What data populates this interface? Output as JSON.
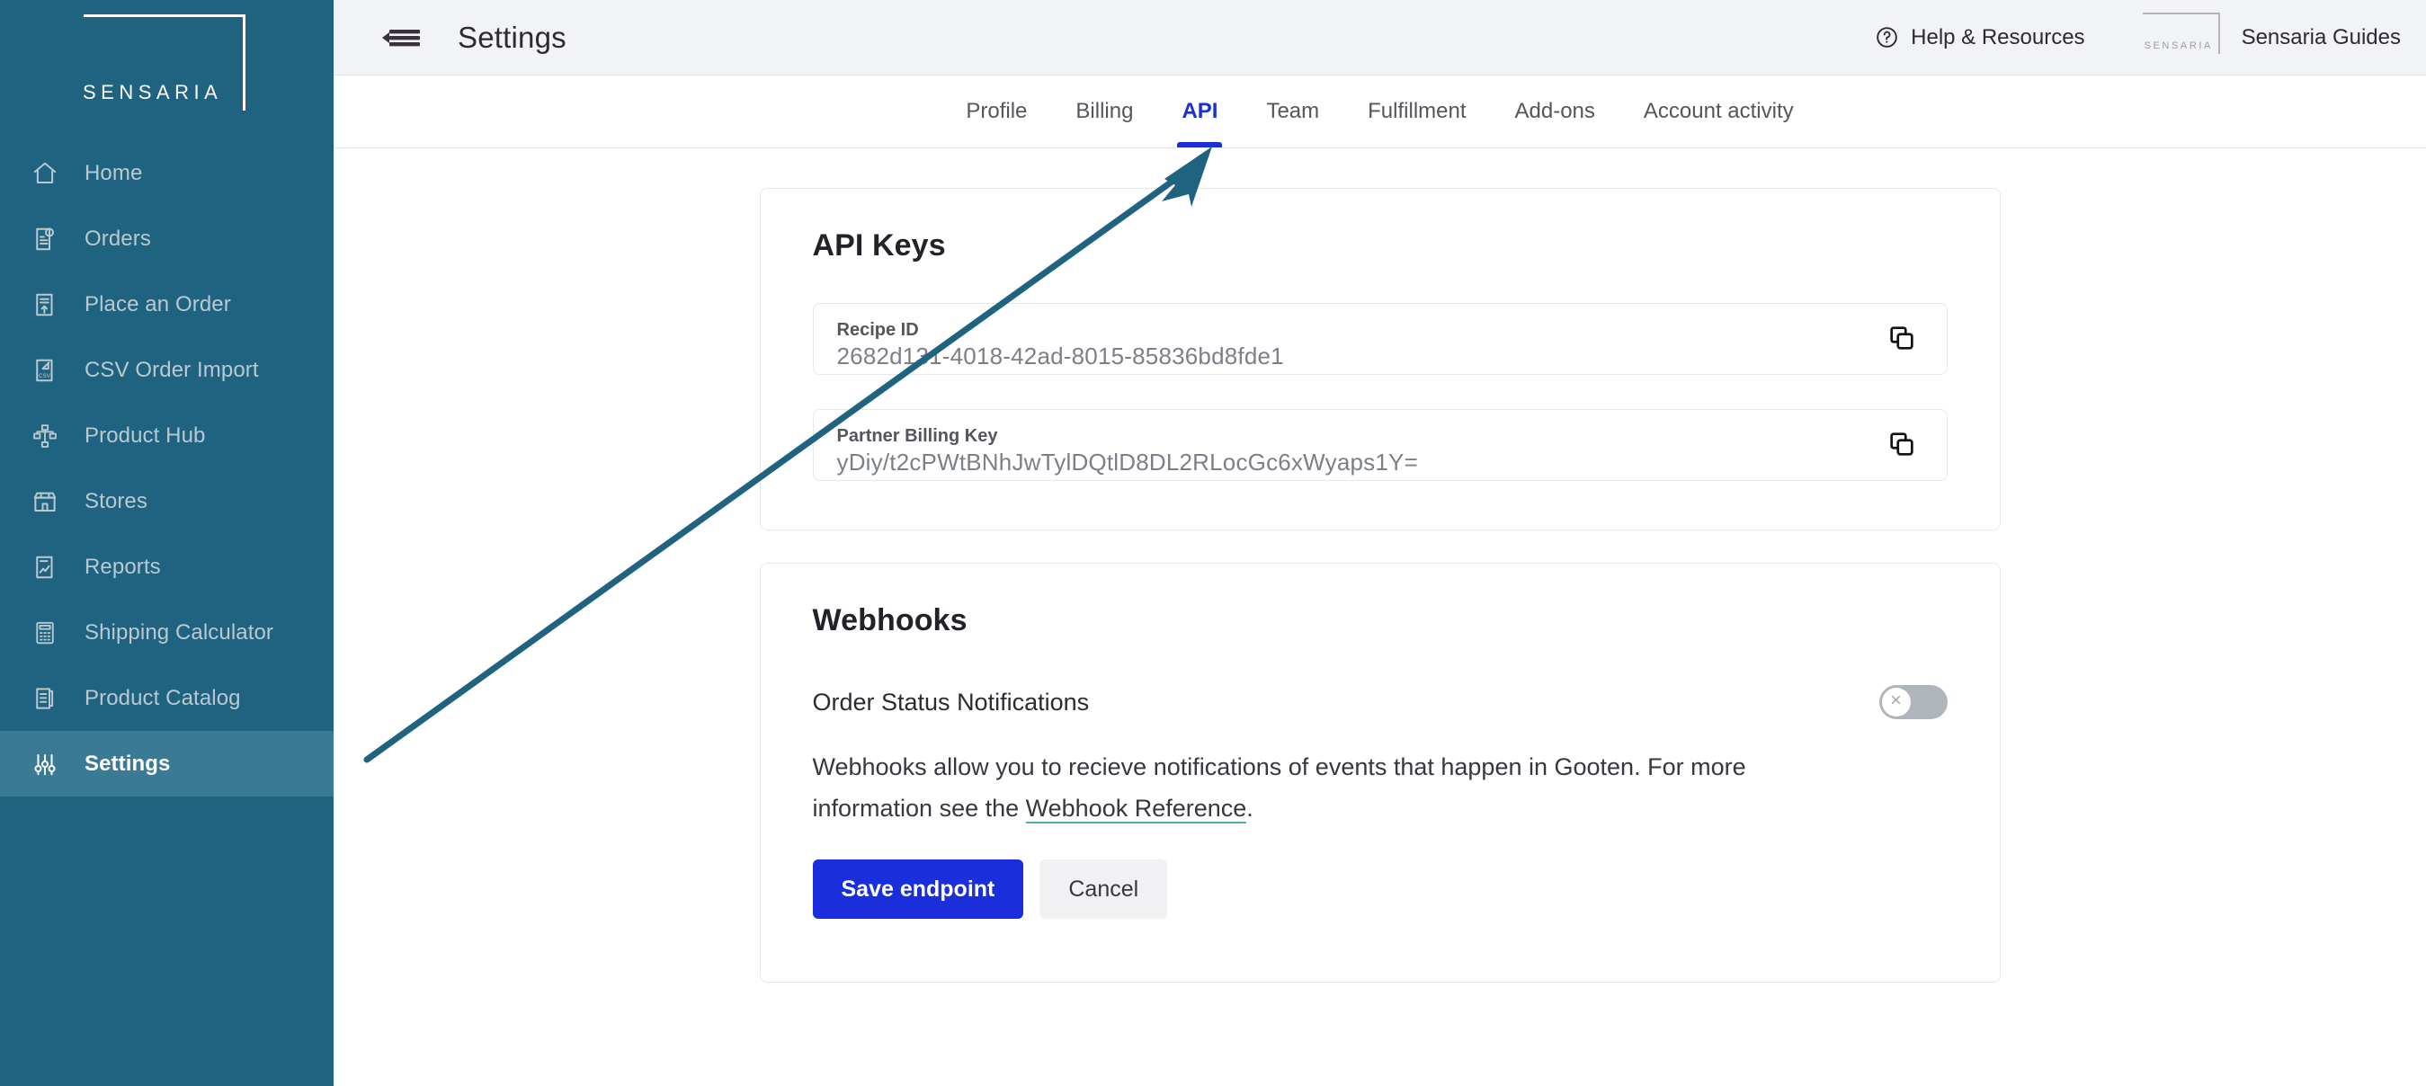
{
  "brand": {
    "logo_text": "SENSARIA",
    "mini_logo_text": "SENSARIA",
    "sidebar_color": "#1F6380",
    "active_item_color": "#3B7A94",
    "accent_color": "#1A2EDB",
    "link_underline_color": "#49b3a5",
    "annotation_color": "#1F6380"
  },
  "sidebar": {
    "items": [
      {
        "label": "Home",
        "icon": "home-icon",
        "active": false
      },
      {
        "label": "Orders",
        "icon": "orders-icon",
        "active": false
      },
      {
        "label": "Place an Order",
        "icon": "place-an-order-icon",
        "active": false
      },
      {
        "label": "CSV Order Import",
        "icon": "csv-order-import-icon",
        "active": false
      },
      {
        "label": "Product Hub",
        "icon": "product-hub-icon",
        "active": false
      },
      {
        "label": "Stores",
        "icon": "stores-icon",
        "active": false
      },
      {
        "label": "Reports",
        "icon": "reports-icon",
        "active": false
      },
      {
        "label": "Shipping Calculator",
        "icon": "shipping-calculator-icon",
        "active": false
      },
      {
        "label": "Product Catalog",
        "icon": "product-catalog-icon",
        "active": false
      },
      {
        "label": "Settings",
        "icon": "settings-sliders-icon",
        "active": true
      }
    ]
  },
  "topbar": {
    "menu_icon": "hamburger-collapse-icon",
    "title": "Settings",
    "help_label": "Help & Resources",
    "help_icon": "question-circle-icon",
    "guides_label": "Sensaria Guides"
  },
  "tabs": [
    {
      "label": "Profile",
      "active": false
    },
    {
      "label": "Billing",
      "active": false
    },
    {
      "label": "API",
      "active": true
    },
    {
      "label": "Team",
      "active": false
    },
    {
      "label": "Fulfillment",
      "active": false
    },
    {
      "label": "Add-ons",
      "active": false
    },
    {
      "label": "Account activity",
      "active": false
    }
  ],
  "api_keys_card": {
    "title": "API Keys",
    "fields": [
      {
        "label": "Recipe ID",
        "value": "2682d131-4018-42ad-8015-85836bd8fde1",
        "copy_icon": "copy-icon"
      },
      {
        "label": "Partner Billing Key",
        "value": "yDiy/t2cPWtBNhJwTylDQtlD8DL2RLocGc6xWyaps1Y=",
        "copy_icon": "copy-icon"
      }
    ]
  },
  "webhooks_card": {
    "title": "Webhooks",
    "toggle_label": "Order Status Notifications",
    "toggle_state": "off",
    "toggle_icon": "x-icon",
    "description_before_link": "Webhooks allow you to recieve notifications of events that happen in Gooten. For more information see the ",
    "link_text": "Webhook Reference",
    "description_after_link": ".",
    "save_label": "Save endpoint",
    "cancel_label": "Cancel"
  }
}
